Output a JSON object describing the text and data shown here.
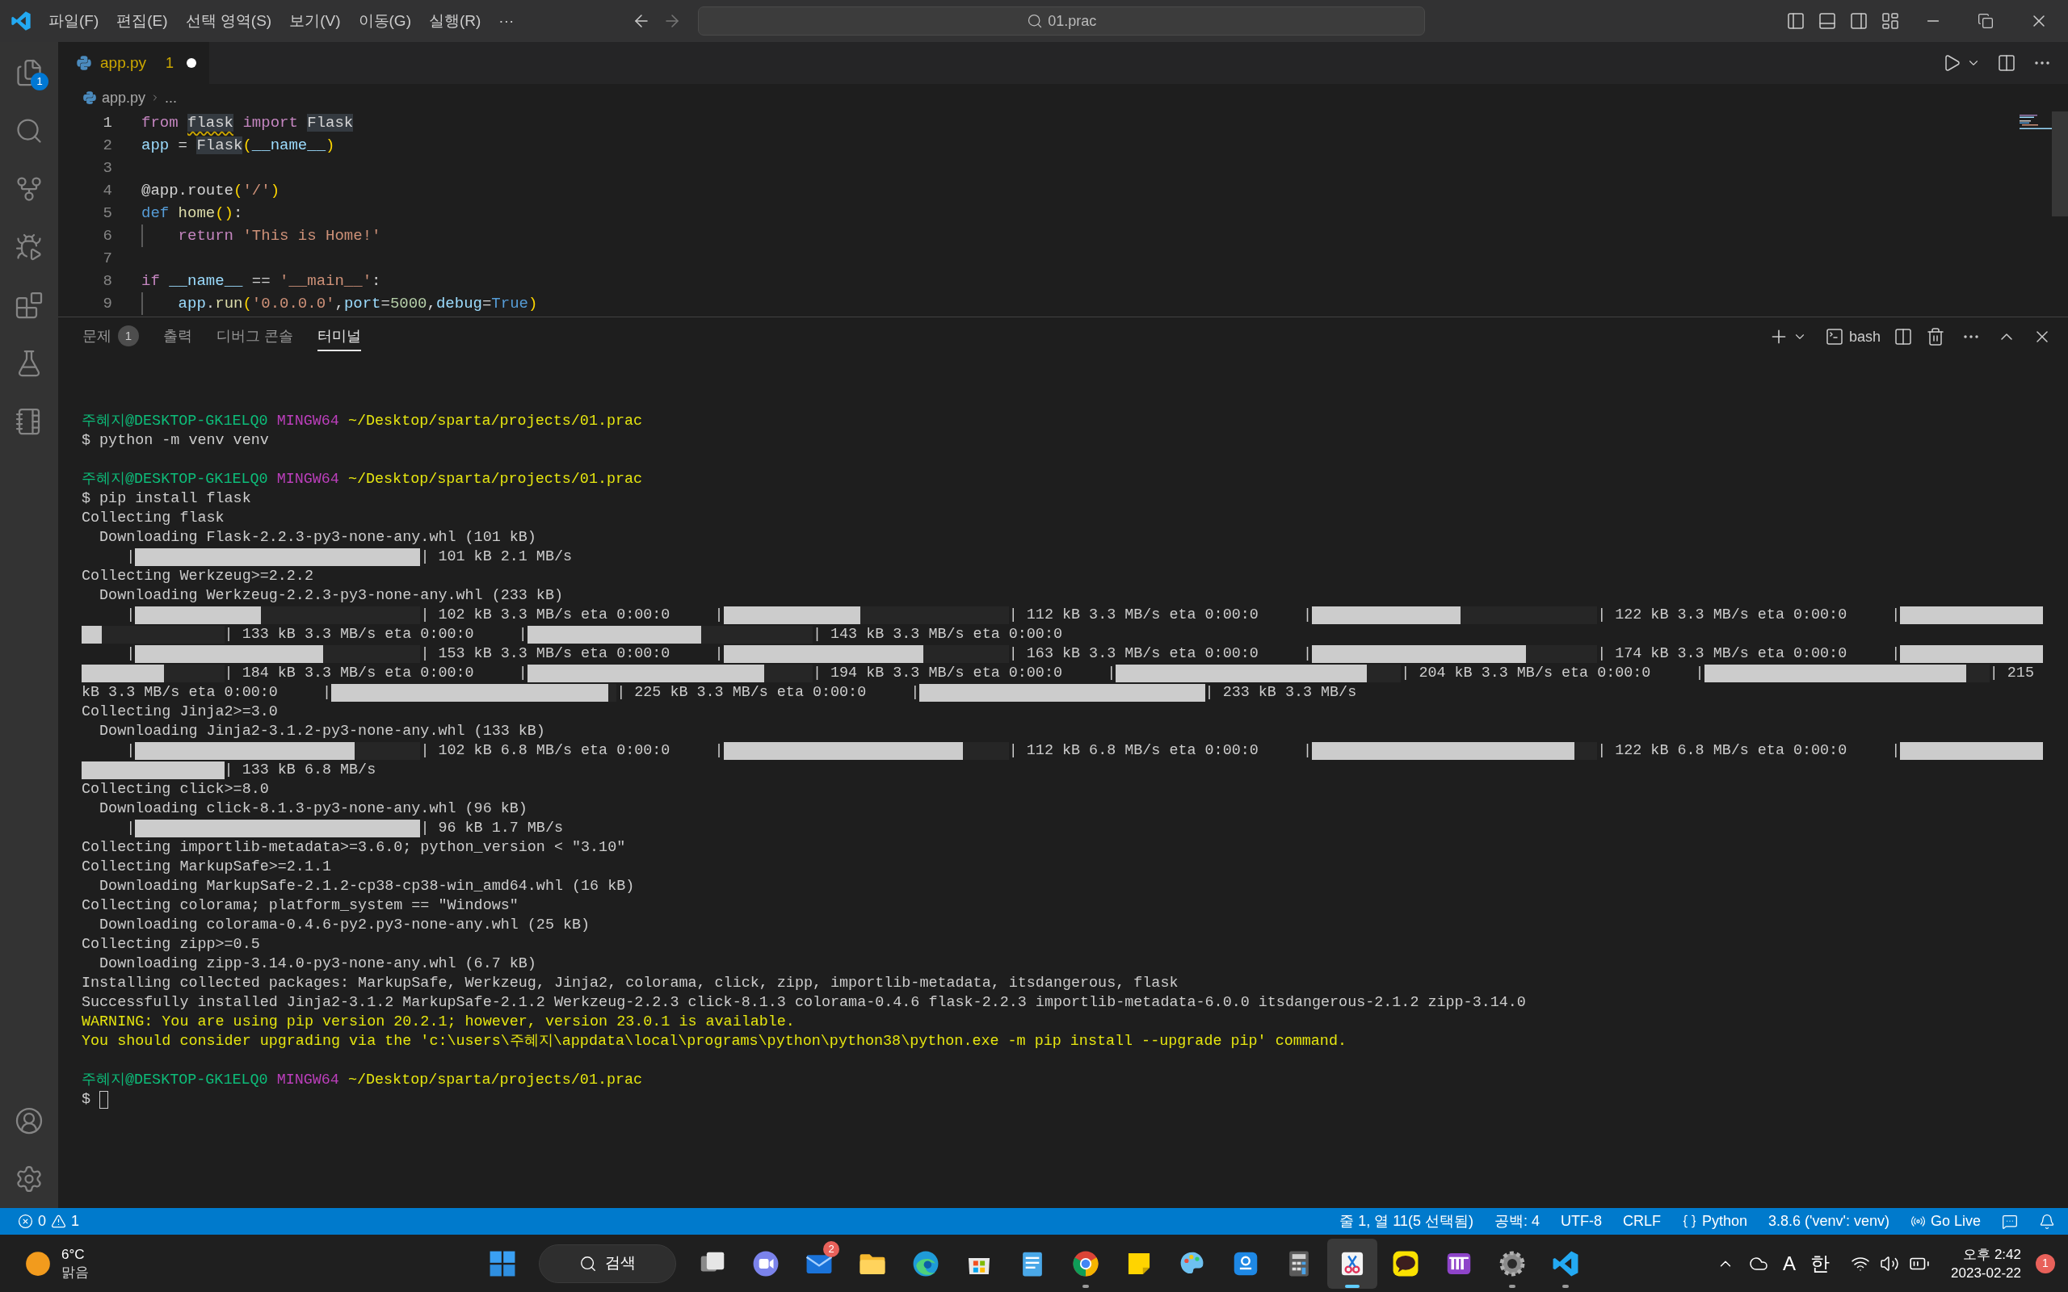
{
  "title_bar": {
    "menu": [
      "파일(F)",
      "편집(E)",
      "선택 영역(S)",
      "보기(V)",
      "이동(G)",
      "실행(R)",
      "···"
    ],
    "command_center": "01.prac"
  },
  "activity_bar": {
    "explorer_badge": "1"
  },
  "tabs": [
    {
      "label": "app.py",
      "problems": "1",
      "dirty": true,
      "selected": true
    }
  ],
  "breadcrumb": {
    "file": "app.py",
    "rest": "..."
  },
  "editor": {
    "lines": [
      {
        "number": "1",
        "active": true,
        "guide": false,
        "tokens": [
          {
            "text": "from ",
            "color": "#c586c0",
            "kind": "plain"
          },
          {
            "text": "flask",
            "kind": "warning"
          },
          {
            "text": " import ",
            "color": "#c586c0",
            "kind": "plain"
          },
          {
            "text": "Flask",
            "kind": "match"
          }
        ]
      },
      {
        "number": "2",
        "active": false,
        "guide": false,
        "tokens": [
          {
            "text": "app",
            "color": "#9cdcfe",
            "kind": "plain"
          },
          {
            "text": " = ",
            "kind": "plain"
          },
          {
            "text": "Flask",
            "kind": "match"
          },
          {
            "text": "(",
            "color": "#ffd700",
            "kind": "plain"
          },
          {
            "text": "__name__",
            "color": "#9cdcfe",
            "kind": "plain"
          },
          {
            "text": ")",
            "color": "#ffd700",
            "kind": "plain"
          }
        ]
      },
      {
        "number": "3",
        "active": false,
        "guide": false
      },
      {
        "number": "4",
        "active": false,
        "guide": false,
        "tokens": [
          {
            "text": "@app.route",
            "kind": "plain"
          },
          {
            "text": "(",
            "color": "#ffd700",
            "kind": "plain"
          },
          {
            "text": "'/'",
            "color": "#ce9178",
            "kind": "plain"
          },
          {
            "text": ")",
            "color": "#ffd700",
            "kind": "plain"
          }
        ]
      },
      {
        "number": "5",
        "active": false,
        "guide": false,
        "tokens": [
          {
            "text": "def ",
            "color": "#569cd6",
            "kind": "plain"
          },
          {
            "text": "home",
            "color": "#dcdcaa",
            "kind": "plain"
          },
          {
            "text": "()",
            "color": "#ffd700",
            "kind": "plain"
          },
          {
            "text": ":",
            "kind": "plain"
          }
        ]
      },
      {
        "number": "6",
        "active": false,
        "guide": true,
        "tokens": [
          {
            "text": "    return ",
            "color": "#c586c0",
            "kind": "plain"
          },
          {
            "text": "'This is Home!'",
            "color": "#ce9178",
            "kind": "plain"
          }
        ]
      },
      {
        "number": "7",
        "active": false,
        "guide": false
      },
      {
        "number": "8",
        "active": false,
        "guide": false,
        "tokens": [
          {
            "text": "if ",
            "color": "#c586c0",
            "kind": "plain"
          },
          {
            "text": "__name__",
            "color": "#9cdcfe",
            "kind": "plain"
          },
          {
            "text": " == ",
            "kind": "plain"
          },
          {
            "text": "'__main__'",
            "color": "#ce9178",
            "kind": "plain"
          },
          {
            "text": ":",
            "kind": "plain"
          }
        ]
      },
      {
        "number": "9",
        "active": false,
        "guide": true,
        "tokens": [
          {
            "text": "    app",
            "color": "#9cdcfe",
            "kind": "plain"
          },
          {
            "text": ".",
            "kind": "plain"
          },
          {
            "text": "run",
            "color": "#dcdcaa",
            "kind": "plain"
          },
          {
            "text": "(",
            "color": "#ffd700",
            "kind": "plain"
          },
          {
            "text": "'0.0.0.0'",
            "color": "#ce9178",
            "kind": "plain"
          },
          {
            "text": ",",
            "kind": "plain"
          },
          {
            "text": "port",
            "color": "#9cdcfe",
            "kind": "plain"
          },
          {
            "text": "=",
            "kind": "plain"
          },
          {
            "text": "5000",
            "color": "#b5cea8",
            "kind": "plain"
          },
          {
            "text": ",",
            "kind": "plain"
          },
          {
            "text": "debug",
            "color": "#9cdcfe",
            "kind": "plain"
          },
          {
            "text": "=",
            "kind": "plain"
          },
          {
            "text": "True",
            "color": "#569cd6",
            "kind": "plain"
          },
          {
            "text": ")",
            "color": "#ffd700",
            "kind": "plain"
          }
        ]
      }
    ]
  },
  "panel": {
    "tabs": [
      {
        "label": "문제",
        "badge": "1",
        "selected": false
      },
      {
        "label": "출력",
        "selected": false
      },
      {
        "label": "디버그 콘솔",
        "selected": false
      },
      {
        "label": "터미널",
        "selected": true
      }
    ],
    "shell": "bash",
    "terminal": {
      "lines": [
        {
          "kind": "output",
          "segments": [
            {
              "kind": "text",
              "text": "주혜지",
              "color": "#0dbc79"
            },
            {
              "kind": "text",
              "text": "@DESKTOP-GK1ELQ0 ",
              "color": "#0dbc79"
            },
            {
              "kind": "text",
              "text": "MINGW64 ",
              "color": "#bc3fbc"
            },
            {
              "kind": "text",
              "text": "~/Desktop/sparta/projects/01.prac",
              "color": "#e5e510"
            }
          ]
        },
        {
          "kind": "output",
          "segments": [
            {
              "kind": "text",
              "text": "$ python -m venv venv"
            }
          ]
        },
        {
          "kind": "blank"
        },
        {
          "kind": "output",
          "segments": [
            {
              "kind": "text",
              "text": "주혜지",
              "color": "#0dbc79"
            },
            {
              "kind": "text",
              "text": "@DESKTOP-GK1ELQ0 ",
              "color": "#0dbc79"
            },
            {
              "kind": "text",
              "text": "MINGW64 ",
              "color": "#bc3fbc"
            },
            {
              "kind": "text",
              "text": "~/Desktop/sparta/projects/01.prac",
              "color": "#e5e510"
            }
          ]
        },
        {
          "kind": "output",
          "segments": [
            {
              "kind": "text",
              "text": "$ pip install flask"
            }
          ]
        },
        {
          "kind": "output",
          "segments": [
            {
              "kind": "text",
              "text": "Collecting flask"
            }
          ]
        },
        {
          "kind": "output",
          "segments": [
            {
              "kind": "text",
              "text": "  Downloading Flask-2.2.3-py3-none-any.whl (101 kB)"
            }
          ]
        },
        {
          "kind": "output",
          "segments": [
            {
              "kind": "text",
              "text": "     |"
            },
            {
              "kind": "bar",
              "level": 1
            },
            {
              "kind": "text",
              "text": "| 101 kB 2.1 MB/s"
            }
          ]
        },
        {
          "kind": "output",
          "segments": [
            {
              "kind": "text",
              "text": "Collecting Werkzeug>=2.2.2"
            }
          ]
        },
        {
          "kind": "output",
          "segments": [
            {
              "kind": "text",
              "text": "  Downloading Werkzeug-2.2.3-py3-none-any.whl (233 kB)"
            }
          ]
        },
        {
          "kind": "output",
          "segments": [
            {
              "kind": "text",
              "text": "     |"
            },
            {
              "kind": "bar",
              "level": 0.44
            },
            {
              "kind": "text",
              "text": "| 102 kB 3.3 MB/s eta 0:00:0     |"
            },
            {
              "kind": "bar",
              "level": 0.48
            },
            {
              "kind": "text",
              "text": "| 112 kB 3.3 MB/s eta 0:00:0     |"
            },
            {
              "kind": "bar",
              "level": 0.52
            },
            {
              "kind": "text",
              "text": "| 122 kB 3.3 MB/s eta 0:00:0     |"
            },
            {
              "kind": "bar_head",
              "level": 1
            }
          ]
        },
        {
          "kind": "output",
          "segments": [
            {
              "kind": "bar_tail",
              "level": 0.14
            },
            {
              "kind": "text",
              "text": "| 133 kB 3.3 MB/s eta 0:00:0     |"
            },
            {
              "kind": "bar",
              "level": 0.61
            },
            {
              "kind": "text",
              "text": "| 143 kB 3.3 MB/s eta 0:00:0"
            }
          ]
        },
        {
          "kind": "output",
          "segments": [
            {
              "kind": "text",
              "text": "     |"
            },
            {
              "kind": "bar",
              "level": 0.66
            },
            {
              "kind": "text",
              "text": "| 153 kB 3.3 MB/s eta 0:00:0     |"
            },
            {
              "kind": "bar",
              "level": 0.7
            },
            {
              "kind": "text",
              "text": "| 163 kB 3.3 MB/s eta 0:00:0     |"
            },
            {
              "kind": "bar",
              "level": 0.75
            },
            {
              "kind": "text",
              "text": "| 174 kB 3.3 MB/s eta 0:00:0     |"
            },
            {
              "kind": "bar_head",
              "level": 1
            }
          ]
        },
        {
          "kind": "output",
          "segments": [
            {
              "kind": "bar_tail",
              "level": 0.58
            },
            {
              "kind": "text",
              "text": "| 184 kB 3.3 MB/s eta 0:00:0     |"
            },
            {
              "kind": "bar",
              "level": 0.83
            },
            {
              "kind": "text",
              "text": "| 194 kB 3.3 MB/s eta 0:00:0     |"
            },
            {
              "kind": "bar",
              "level": 0.88
            },
            {
              "kind": "text",
              "text": "| 204 kB 3.3 MB/s eta 0:00:0     |"
            },
            {
              "kind": "bar",
              "level": 0.92
            },
            {
              "kind": "text",
              "text": "| 215"
            }
          ]
        },
        {
          "kind": "output",
          "segments": [
            {
              "kind": "text",
              "text": "kB 3.3 MB/s eta 0:00:0     |"
            },
            {
              "kind": "bar",
              "level": 0.97
            },
            {
              "kind": "text",
              "text": "| 225 kB 3.3 MB/s eta 0:00:0     |"
            },
            {
              "kind": "bar",
              "level": 1
            },
            {
              "kind": "text",
              "text": "| 233 kB 3.3 MB/s"
            }
          ]
        },
        {
          "kind": "output",
          "segments": [
            {
              "kind": "text",
              "text": "Collecting Jinja2>=3.0"
            }
          ]
        },
        {
          "kind": "output",
          "segments": [
            {
              "kind": "text",
              "text": "  Downloading Jinja2-3.1.2-py3-none-any.whl (133 kB)"
            }
          ]
        },
        {
          "kind": "output",
          "segments": [
            {
              "kind": "text",
              "text": "     |"
            },
            {
              "kind": "bar",
              "level": 0.77
            },
            {
              "kind": "text",
              "text": "| 102 kB 6.8 MB/s eta 0:00:0     |"
            },
            {
              "kind": "bar",
              "level": 0.84
            },
            {
              "kind": "text",
              "text": "| 112 kB 6.8 MB/s eta 0:00:0     |"
            },
            {
              "kind": "bar",
              "level": 0.92
            },
            {
              "kind": "text",
              "text": "| 122 kB 6.8 MB/s eta 0:00:0     |"
            },
            {
              "kind": "bar_head",
              "level": 1
            }
          ]
        },
        {
          "kind": "output",
          "segments": [
            {
              "kind": "bar_tail",
              "level": 1
            },
            {
              "kind": "text",
              "text": "| 133 kB 6.8 MB/s"
            }
          ]
        },
        {
          "kind": "output",
          "segments": [
            {
              "kind": "text",
              "text": "Collecting click>=8.0"
            }
          ]
        },
        {
          "kind": "output",
          "segments": [
            {
              "kind": "text",
              "text": "  Downloading click-8.1.3-py3-none-any.whl (96 kB)"
            }
          ]
        },
        {
          "kind": "output",
          "segments": [
            {
              "kind": "text",
              "text": "     |"
            },
            {
              "kind": "bar",
              "level": 1
            },
            {
              "kind": "text",
              "text": "| 96 kB 1.7 MB/s"
            }
          ]
        },
        {
          "kind": "output",
          "segments": [
            {
              "kind": "text",
              "text": "Collecting importlib-metadata>=3.6.0; python_version < \"3.10\""
            }
          ]
        },
        {
          "kind": "output",
          "segments": [
            {
              "kind": "text",
              "text": "Collecting MarkupSafe>=2.1.1"
            }
          ]
        },
        {
          "kind": "output",
          "segments": [
            {
              "kind": "text",
              "text": "  Downloading MarkupSafe-2.1.2-cp38-cp38-win_amd64.whl (16 kB)"
            }
          ]
        },
        {
          "kind": "output",
          "segments": [
            {
              "kind": "text",
              "text": "Collecting colorama; platform_system == \"Windows\""
            }
          ]
        },
        {
          "kind": "output",
          "segments": [
            {
              "kind": "text",
              "text": "  Downloading colorama-0.4.6-py2.py3-none-any.whl (25 kB)"
            }
          ]
        },
        {
          "kind": "output",
          "segments": [
            {
              "kind": "text",
              "text": "Collecting zipp>=0.5"
            }
          ]
        },
        {
          "kind": "output",
          "segments": [
            {
              "kind": "text",
              "text": "  Downloading zipp-3.14.0-py3-none-any.whl (6.7 kB)"
            }
          ]
        },
        {
          "kind": "output",
          "segments": [
            {
              "kind": "text",
              "text": "Installing collected packages: MarkupSafe, Werkzeug, Jinja2, colorama, click, zipp, importlib-metadata, itsdangerous, flask"
            }
          ]
        },
        {
          "kind": "output",
          "segments": [
            {
              "kind": "text",
              "text": "Successfully installed Jinja2-3.1.2 MarkupSafe-2.1.2 Werkzeug-2.2.3 click-8.1.3 colorama-0.4.6 flask-2.2.3 importlib-metadata-6.0.0 itsdangerous-2.1.2 zipp-3.14.0"
            }
          ]
        },
        {
          "kind": "output",
          "segments": [
            {
              "kind": "text",
              "text": "WARNING: You are using pip version 20.2.1; however, version 23.0.1 is available.",
              "color": "#e5e510"
            }
          ]
        },
        {
          "kind": "output",
          "segments": [
            {
              "kind": "text",
              "text": "You should consider upgrading via the 'c:\\users\\주혜지\\appdata\\local\\programs\\python\\python38\\python.exe -m pip install --upgrade pip' command.",
              "color": "#e5e510"
            }
          ]
        },
        {
          "kind": "blank"
        },
        {
          "kind": "output",
          "segments": [
            {
              "kind": "text",
              "text": "주혜지",
              "color": "#0dbc79"
            },
            {
              "kind": "text",
              "text": "@DESKTOP-GK1ELQ0 ",
              "color": "#0dbc79"
            },
            {
              "kind": "text",
              "text": "MINGW64 ",
              "color": "#bc3fbc"
            },
            {
              "kind": "text",
              "text": "~/Desktop/sparta/projects/01.prac",
              "color": "#e5e510"
            }
          ]
        },
        {
          "kind": "output",
          "segments": [
            {
              "kind": "text",
              "text": "$ "
            },
            {
              "kind": "cursor"
            }
          ]
        }
      ]
    }
  },
  "status_bar": {
    "errors": "0",
    "warnings": "1",
    "items": [
      {
        "kind": "text",
        "text": "줄 1, 열 11(5 선택됨)"
      },
      {
        "kind": "text",
        "text": "공백: 4"
      },
      {
        "kind": "text",
        "text": "UTF-8"
      },
      {
        "kind": "text",
        "text": "CRLF"
      },
      {
        "kind": "language",
        "text": "Python"
      },
      {
        "kind": "text",
        "text": "3.8.6 ('venv': venv)"
      },
      {
        "kind": "golive",
        "text": "Go Live"
      }
    ]
  },
  "taskbar": {
    "weather": {
      "temperature": "6°C",
      "condition": "맑음"
    },
    "search": "검색",
    "apps": [
      {
        "kind": "start",
        "running": false,
        "selected": false
      },
      {
        "kind": "search"
      },
      {
        "kind": "taskview",
        "running": false,
        "selected": false
      },
      {
        "kind": "chat",
        "running": false,
        "selected": false
      },
      {
        "kind": "mail",
        "running": false,
        "selected": false,
        "badge": "2"
      },
      {
        "kind": "folder",
        "running": false,
        "selected": false
      },
      {
        "kind": "edge",
        "running": false,
        "selected": false
      },
      {
        "kind": "store",
        "running": false,
        "selected": false
      },
      {
        "kind": "notepad",
        "running": false,
        "selected": false
      },
      {
        "kind": "chrome",
        "running": true,
        "selected": false
      },
      {
        "kind": "sticky",
        "running": false,
        "selected": false
      },
      {
        "kind": "paint",
        "running": false,
        "selected": false
      },
      {
        "kind": "bluetile",
        "running": false,
        "selected": false
      },
      {
        "kind": "calculator",
        "running": false,
        "selected": false
      },
      {
        "kind": "snip",
        "running": true,
        "selected": true
      },
      {
        "kind": "kakao",
        "running": false,
        "selected": false
      },
      {
        "kind": "purpletile",
        "running": false,
        "selected": false
      },
      {
        "kind": "settings",
        "running": true,
        "selected": false
      },
      {
        "kind": "vscode",
        "running": true,
        "selected": false
      }
    ],
    "ime": "A",
    "language": "한",
    "time": "오후 2:42",
    "date": "2023-02-22",
    "notifications": "1"
  }
}
